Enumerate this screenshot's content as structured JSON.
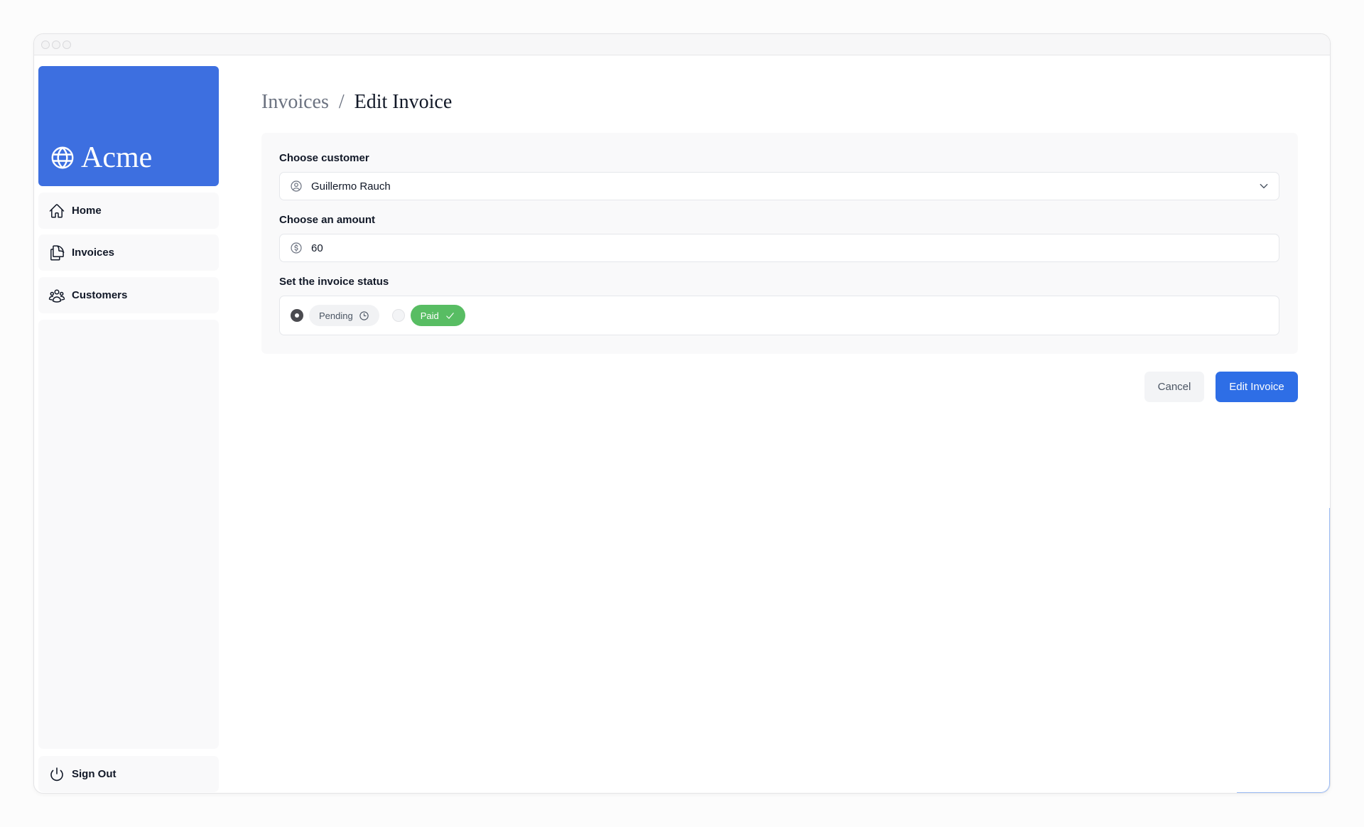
{
  "window": {
    "controls": [
      "close",
      "minimize",
      "maximize"
    ]
  },
  "sidebar": {
    "brand": {
      "name": "Acme",
      "icon": "globe-icon",
      "color": "#3d6fe0"
    },
    "items": [
      {
        "label": "Home",
        "icon": "home-icon"
      },
      {
        "label": "Invoices",
        "icon": "document-duplicate-icon"
      },
      {
        "label": "Customers",
        "icon": "user-group-icon"
      }
    ],
    "sign_out": {
      "label": "Sign Out",
      "icon": "power-icon"
    }
  },
  "breadcrumb": {
    "parent": "Invoices",
    "separator": "/",
    "current": "Edit Invoice"
  },
  "form": {
    "customer": {
      "label": "Choose customer",
      "selected": "Guillermo Rauch",
      "icon": "user-circle-icon"
    },
    "amount": {
      "label": "Choose an amount",
      "value": "60",
      "icon": "currency-dollar-icon"
    },
    "status": {
      "label": "Set the invoice status",
      "options": [
        {
          "label": "Pending",
          "icon": "clock-icon",
          "checked": true
        },
        {
          "label": "Paid",
          "icon": "check-icon",
          "checked": false,
          "color": "#58bd63"
        }
      ]
    }
  },
  "actions": {
    "cancel_label": "Cancel",
    "submit_label": "Edit Invoice",
    "submit_color": "#2e6ee6"
  }
}
